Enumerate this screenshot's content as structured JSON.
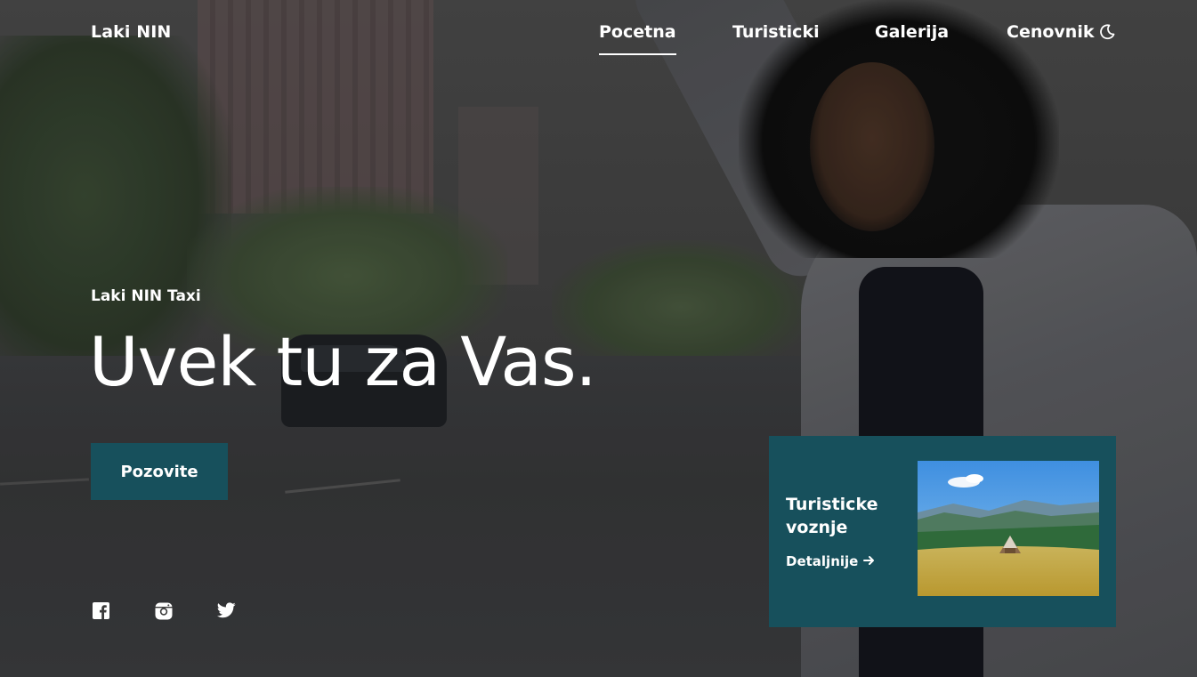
{
  "brand": {
    "name": "Laki NIN"
  },
  "nav": {
    "items": [
      {
        "label": "Pocetna",
        "active": true
      },
      {
        "label": "Turisticki",
        "active": false
      },
      {
        "label": "Galerija",
        "active": false
      },
      {
        "label": "Cenovnik",
        "active": false
      }
    ],
    "theme_toggle_icon": "moon-icon"
  },
  "hero": {
    "eyebrow": "Laki NIN Taxi",
    "headline": "Uvek tu za Vas.",
    "cta_label": "Pozovite"
  },
  "social": {
    "icons": [
      "facebook-icon",
      "instagram-icon",
      "twitter-icon"
    ]
  },
  "card": {
    "title": "Turisticke voznje",
    "link_label": "Detaljnije",
    "link_icon": "arrow-right-icon",
    "image": "mountain-landscape-with-hut"
  },
  "colors": {
    "accent": "#17505c",
    "text": "#ffffff"
  }
}
